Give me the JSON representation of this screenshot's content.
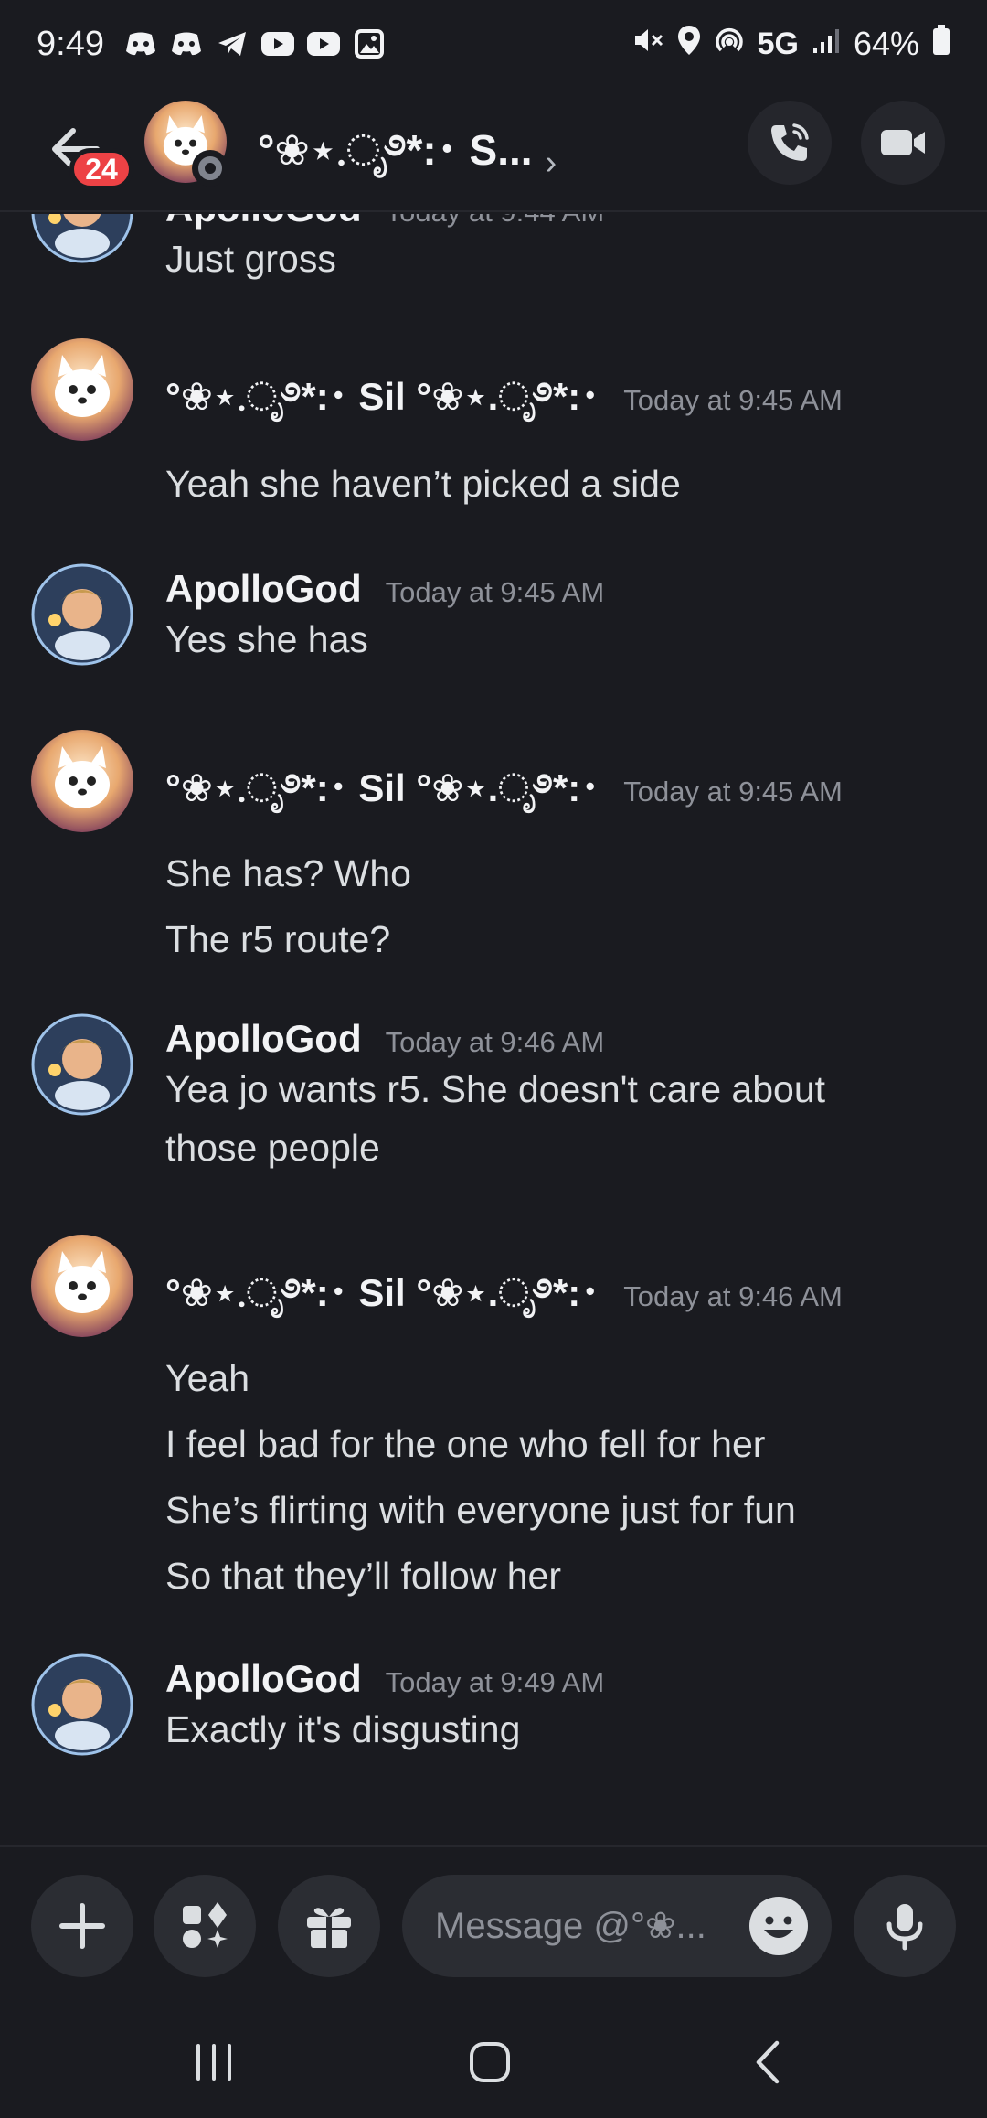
{
  "status_bar": {
    "time": "9:49",
    "network": "5G",
    "battery": "64%"
  },
  "header": {
    "badge_count": "24",
    "title": "°❀⋆.ೃ࿔*:･ S..."
  },
  "messages": {
    "m0": {
      "text": "Just gross",
      "partial_header": "ApolloGod   Today at 9:44 AM"
    },
    "m1": {
      "author": "°❀⋆.ೃ࿔*:･ Sil °❀⋆.ೃ࿔*:･",
      "timestamp": "Today at 9:45 AM",
      "lines": [
        "Yeah she haven’t picked a side"
      ]
    },
    "m2": {
      "author": "ApolloGod",
      "timestamp": "Today at 9:45 AM",
      "lines": [
        "Yes she has"
      ]
    },
    "m3": {
      "author": "°❀⋆.ೃ࿔*:･ Sil °❀⋆.ೃ࿔*:･",
      "timestamp": "Today at 9:45 AM",
      "lines": [
        "She has? Who",
        "The r5 route?"
      ]
    },
    "m4": {
      "author": "ApolloGod",
      "timestamp": "Today at 9:46 AM",
      "lines": [
        "Yea jo wants r5. She doesn't care about",
        "those people"
      ]
    },
    "m5": {
      "author": "°❀⋆.ೃ࿔*:･ Sil °❀⋆.ೃ࿔*:･",
      "timestamp": "Today at 9:46 AM",
      "lines": [
        "Yeah",
        "I feel bad for the one who fell for her",
        "She’s flirting with everyone just for fun",
        "So that they’ll follow her"
      ]
    },
    "m6": {
      "author": "ApolloGod",
      "timestamp": "Today at 9:49 AM",
      "lines": [
        "Exactly it's disgusting"
      ]
    }
  },
  "composer": {
    "placeholder": "Message @°❀..."
  },
  "colors": {
    "background": "#1a1b20",
    "badge": "#ed4245",
    "button_bg": "#2b2d33",
    "timestamp": "#8e9199"
  },
  "icons": {
    "back": "arrow-left-icon",
    "call": "phone-icon",
    "video": "video-camera-icon",
    "add": "plus-icon",
    "apps": "apps-icon",
    "gift": "gift-icon",
    "emoji": "emoji-icon",
    "mic": "microphone-icon"
  }
}
